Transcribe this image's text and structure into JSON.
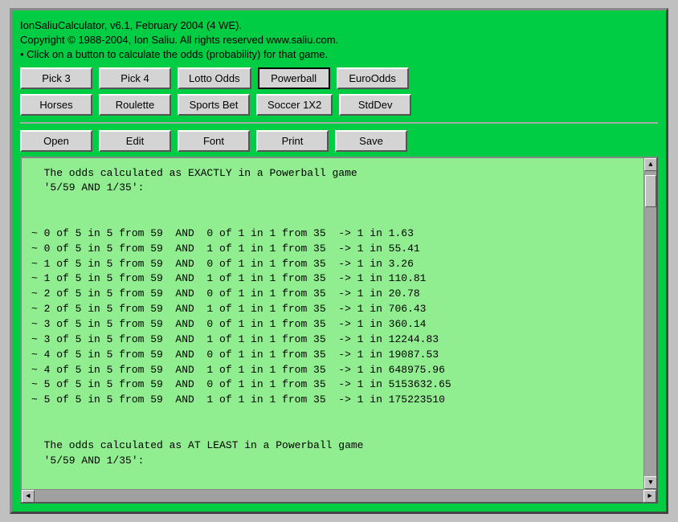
{
  "header": {
    "line1": "IonSaliuCalculator, v6.1, February 2004 (4 WE).",
    "line2": "Copyright © 1988-2004, Ion Saliu. All rights reserved www.saliu.com.",
    "line3": "• Click on a button to calculate the odds (probability) for that game."
  },
  "buttons_row1": [
    {
      "label": "Pick 3",
      "name": "pick3-button",
      "active": false
    },
    {
      "label": "Pick 4",
      "name": "pick4-button",
      "active": false
    },
    {
      "label": "Lotto Odds",
      "name": "lotto-odds-button",
      "active": false
    },
    {
      "label": "Powerball",
      "name": "powerball-button",
      "active": true
    },
    {
      "label": "EuroOdds",
      "name": "euroodds-button",
      "active": false
    }
  ],
  "buttons_row2": [
    {
      "label": "Horses",
      "name": "horses-button",
      "active": false
    },
    {
      "label": "Roulette",
      "name": "roulette-button",
      "active": false
    },
    {
      "label": "Sports Bet",
      "name": "sports-bet-button",
      "active": false
    },
    {
      "label": "Soccer 1X2",
      "name": "soccer-button",
      "active": false
    },
    {
      "label": "StdDev",
      "name": "stddev-button",
      "active": false
    }
  ],
  "buttons_row3": [
    {
      "label": "Open",
      "name": "open-button",
      "active": false
    },
    {
      "label": "Edit",
      "name": "edit-button",
      "active": false
    },
    {
      "label": "Font",
      "name": "font-button",
      "active": false
    },
    {
      "label": "Print",
      "name": "print-button",
      "active": false
    },
    {
      "label": "Save",
      "name": "save-button",
      "active": false
    }
  ],
  "output": {
    "content": "  The odds calculated as EXACTLY in a Powerball game\n  '5/59 AND 1/35':\n\n\n~ 0 of 5 in 5 from 59  AND  0 of 1 in 1 from 35  -> 1 in 1.63\n~ 0 of 5 in 5 from 59  AND  1 of 1 in 1 from 35  -> 1 in 55.41\n~ 1 of 5 in 5 from 59  AND  0 of 1 in 1 from 35  -> 1 in 3.26\n~ 1 of 5 in 5 from 59  AND  1 of 1 in 1 from 35  -> 1 in 110.81\n~ 2 of 5 in 5 from 59  AND  0 of 1 in 1 from 35  -> 1 in 20.78\n~ 2 of 5 in 5 from 59  AND  1 of 1 in 1 from 35  -> 1 in 706.43\n~ 3 of 5 in 5 from 59  AND  0 of 1 in 1 from 35  -> 1 in 360.14\n~ 3 of 5 in 5 from 59  AND  1 of 1 in 1 from 35  -> 1 in 12244.83\n~ 4 of 5 in 5 from 59  AND  0 of 1 in 1 from 35  -> 1 in 19087.53\n~ 4 of 5 in 5 from 59  AND  1 of 1 in 1 from 35  -> 1 in 648975.96\n~ 5 of 5 in 5 from 59  AND  0 of 1 in 1 from 35  -> 1 in 5153632.65\n~ 5 of 5 in 5 from 59  AND  1 of 1 in 1 from 35  -> 1 in 175223510\n\n\n  The odds calculated as AT LEAST in a Powerball game\n  '5/59 AND 1/35':\n"
  }
}
